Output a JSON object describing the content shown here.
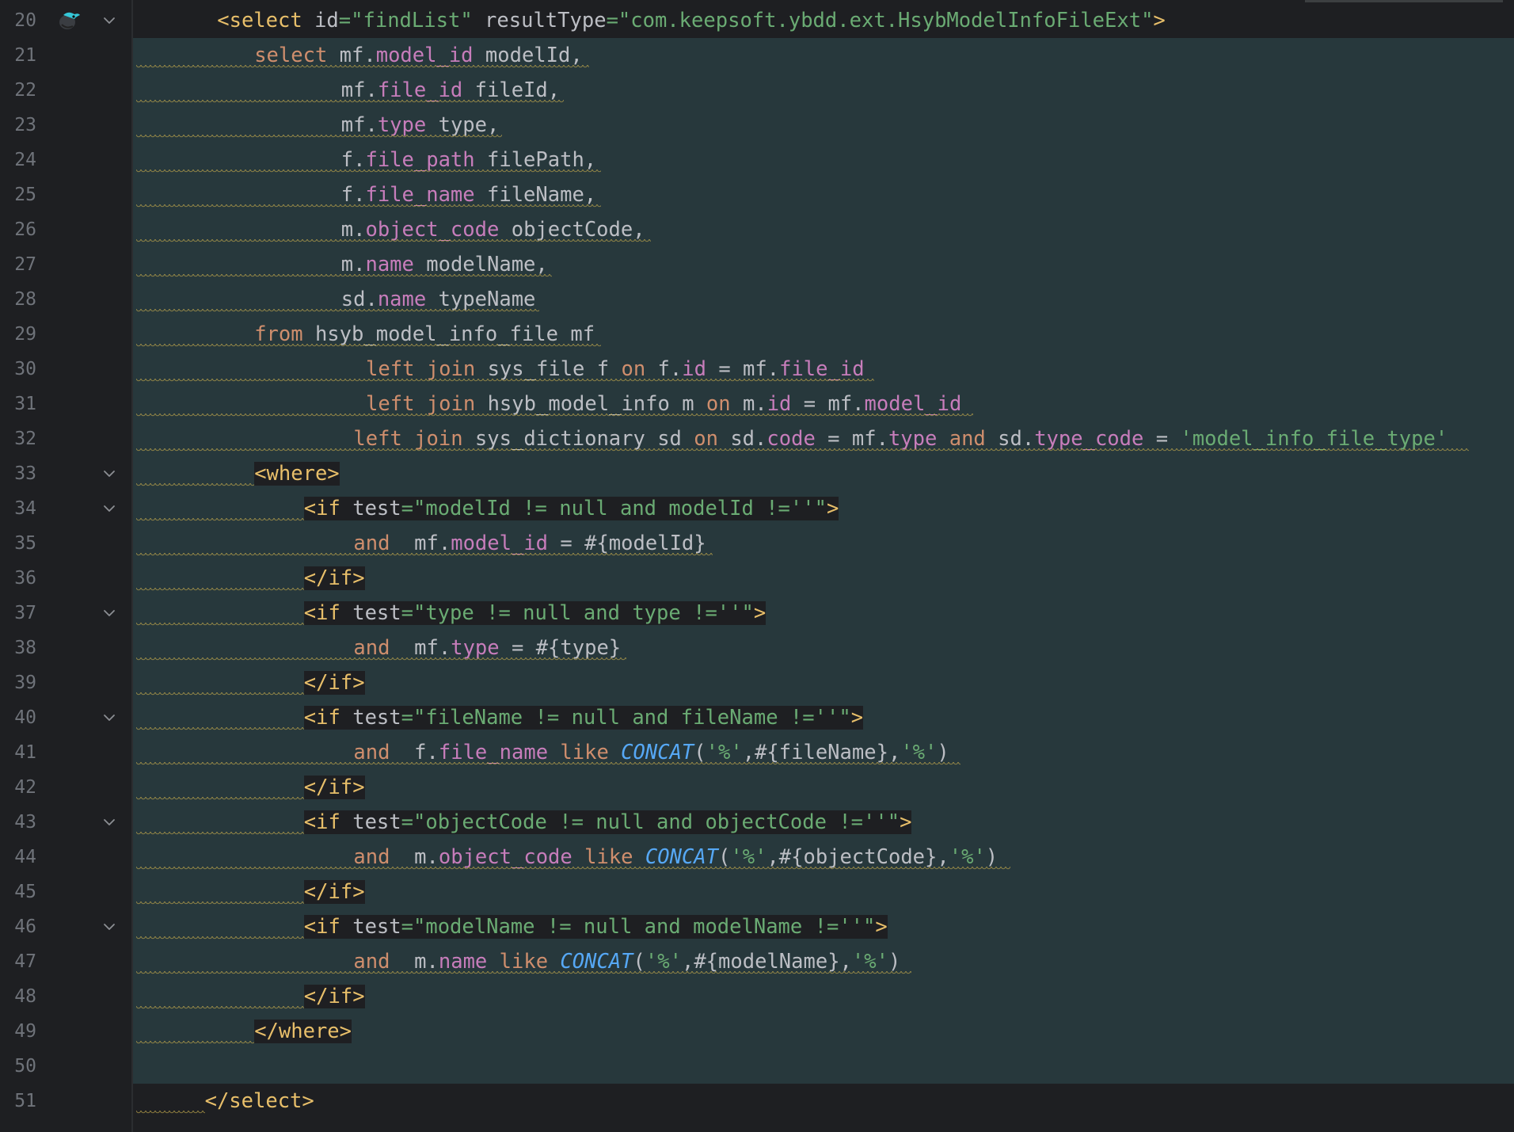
{
  "editor": {
    "file_language": "MyBatis mapper XML",
    "colors": {
      "background": "#1e1f22",
      "injected_background": "#27383c",
      "tag": "#e8bf6a",
      "keyword": "#cf8e6d",
      "field": "#c77dbb",
      "string": "#6aab73",
      "function": "#56a8f5",
      "line_number": "#6f737a",
      "warning_squiggle": "#bda54b"
    }
  },
  "lines": [
    {
      "num": "20",
      "indent": 5,
      "fold": true,
      "icon": "mapper-bird-icon",
      "bg": "none",
      "tokens": [
        {
          "t": "<select ",
          "c": "tag",
          "box": true
        },
        {
          "t": "id",
          "c": "attr",
          "box": true
        },
        {
          "t": "=\"findList\" ",
          "c": "aval",
          "box": true
        },
        {
          "t": "resultType",
          "c": "attr",
          "box": true
        },
        {
          "t": "=\"com.keepsoft.ybdd.ext.HsybModelInfoFileExt\"",
          "c": "aval",
          "box": true
        },
        {
          "t": ">",
          "c": "tag",
          "box": true
        }
      ]
    },
    {
      "num": "21",
      "indent": 8,
      "bg": "inj",
      "tokens": [
        {
          "t": "select ",
          "c": "kw"
        },
        {
          "t": "mf.",
          "c": "id"
        },
        {
          "t": "model_id",
          "c": "fld"
        },
        {
          "t": " modelId,",
          "c": "id"
        }
      ]
    },
    {
      "num": "22",
      "indent": 15,
      "bg": "inj",
      "tokens": [
        {
          "t": "mf.",
          "c": "id"
        },
        {
          "t": "file_id",
          "c": "fld"
        },
        {
          "t": " fileId,",
          "c": "id"
        }
      ]
    },
    {
      "num": "23",
      "indent": 15,
      "bg": "inj",
      "tokens": [
        {
          "t": "mf.",
          "c": "id"
        },
        {
          "t": "type",
          "c": "fld"
        },
        {
          "t": " type,",
          "c": "id"
        }
      ]
    },
    {
      "num": "24",
      "indent": 15,
      "bg": "inj",
      "tokens": [
        {
          "t": "f.",
          "c": "id"
        },
        {
          "t": "file_path",
          "c": "fld"
        },
        {
          "t": " filePath,",
          "c": "id"
        }
      ]
    },
    {
      "num": "25",
      "indent": 15,
      "bg": "inj",
      "tokens": [
        {
          "t": "f.",
          "c": "id"
        },
        {
          "t": "file_name",
          "c": "fld"
        },
        {
          "t": " fileName,",
          "c": "id"
        }
      ]
    },
    {
      "num": "26",
      "indent": 15,
      "bg": "inj",
      "tokens": [
        {
          "t": "m.",
          "c": "id"
        },
        {
          "t": "object_code",
          "c": "fld"
        },
        {
          "t": " objectCode,",
          "c": "id"
        }
      ]
    },
    {
      "num": "27",
      "indent": 15,
      "bg": "inj",
      "tokens": [
        {
          "t": "m.",
          "c": "id"
        },
        {
          "t": "name",
          "c": "fld"
        },
        {
          "t": " modelName,",
          "c": "id"
        }
      ]
    },
    {
      "num": "28",
      "indent": 15,
      "bg": "inj",
      "tokens": [
        {
          "t": "sd.",
          "c": "id"
        },
        {
          "t": "name",
          "c": "fld"
        },
        {
          "t": " typeName",
          "c": "id"
        }
      ]
    },
    {
      "num": "29",
      "indent": 8,
      "bg": "inj",
      "tokens": [
        {
          "t": "from ",
          "c": "kw"
        },
        {
          "t": "hsyb_model_info_file mf",
          "c": "id"
        }
      ]
    },
    {
      "num": "30",
      "indent": 17,
      "bg": "inj",
      "tokens": [
        {
          "t": "left join ",
          "c": "kw"
        },
        {
          "t": "sys_file f ",
          "c": "id"
        },
        {
          "t": "on ",
          "c": "kw"
        },
        {
          "t": "f.",
          "c": "id"
        },
        {
          "t": "id",
          "c": "fld"
        },
        {
          "t": " = mf.",
          "c": "id"
        },
        {
          "t": "file_id",
          "c": "fld"
        }
      ]
    },
    {
      "num": "31",
      "indent": 17,
      "bg": "inj",
      "tokens": [
        {
          "t": "left join ",
          "c": "kw"
        },
        {
          "t": "hsyb_model_info m ",
          "c": "id"
        },
        {
          "t": "on ",
          "c": "kw"
        },
        {
          "t": "m.",
          "c": "id"
        },
        {
          "t": "id",
          "c": "fld"
        },
        {
          "t": " = mf.",
          "c": "id"
        },
        {
          "t": "model_id",
          "c": "fld"
        }
      ]
    },
    {
      "num": "32",
      "indent": 16,
      "bg": "inj",
      "tokens": [
        {
          "t": "left join ",
          "c": "kw"
        },
        {
          "t": "sys_dictionary sd ",
          "c": "id"
        },
        {
          "t": "on ",
          "c": "kw"
        },
        {
          "t": "sd.",
          "c": "id"
        },
        {
          "t": "code",
          "c": "fld"
        },
        {
          "t": " = mf.",
          "c": "id"
        },
        {
          "t": "type",
          "c": "fld"
        },
        {
          "t": " and ",
          "c": "kw"
        },
        {
          "t": "sd.",
          "c": "id"
        },
        {
          "t": "type_code",
          "c": "fld"
        },
        {
          "t": " = ",
          "c": "id"
        },
        {
          "t": "'model_info_file_type'",
          "c": "str"
        }
      ]
    },
    {
      "num": "33",
      "indent": 8,
      "fold": true,
      "bg": "inj",
      "tokens": [
        {
          "t": "<where>",
          "c": "tag",
          "box": true
        }
      ]
    },
    {
      "num": "34",
      "indent": 12,
      "fold": true,
      "bg": "inj",
      "tokens": [
        {
          "t": "<if ",
          "c": "tag",
          "box": true
        },
        {
          "t": "test",
          "c": "attr",
          "box": true
        },
        {
          "t": "=\"modelId != null and modelId !=''\"",
          "c": "aval",
          "box": true
        },
        {
          "t": ">",
          "c": "tag",
          "box": true
        }
      ]
    },
    {
      "num": "35",
      "indent": 16,
      "bg": "inj",
      "tokens": [
        {
          "t": "and  ",
          "c": "kw"
        },
        {
          "t": "mf.",
          "c": "id"
        },
        {
          "t": "model_id",
          "c": "fld"
        },
        {
          "t": " = #{modelId}",
          "c": "id"
        }
      ]
    },
    {
      "num": "36",
      "indent": 12,
      "bg": "inj",
      "tokens": [
        {
          "t": "</if>",
          "c": "tag",
          "box": true
        }
      ]
    },
    {
      "num": "37",
      "indent": 12,
      "fold": true,
      "bg": "inj",
      "tokens": [
        {
          "t": "<if ",
          "c": "tag",
          "box": true
        },
        {
          "t": "test",
          "c": "attr",
          "box": true
        },
        {
          "t": "=\"type != null and type !=''\"",
          "c": "aval",
          "box": true
        },
        {
          "t": ">",
          "c": "tag",
          "box": true
        }
      ]
    },
    {
      "num": "38",
      "indent": 16,
      "bg": "inj",
      "tokens": [
        {
          "t": "and  ",
          "c": "kw"
        },
        {
          "t": "mf.",
          "c": "id"
        },
        {
          "t": "type",
          "c": "fld"
        },
        {
          "t": " = #{type}",
          "c": "id"
        }
      ]
    },
    {
      "num": "39",
      "indent": 12,
      "bg": "inj",
      "tokens": [
        {
          "t": "</if>",
          "c": "tag",
          "box": true
        }
      ]
    },
    {
      "num": "40",
      "indent": 12,
      "fold": true,
      "bg": "inj",
      "tokens": [
        {
          "t": "<if ",
          "c": "tag",
          "box": true
        },
        {
          "t": "test",
          "c": "attr",
          "box": true
        },
        {
          "t": "=\"fileName != null and fileName !=''\"",
          "c": "aval",
          "box": true
        },
        {
          "t": ">",
          "c": "tag",
          "box": true
        }
      ]
    },
    {
      "num": "41",
      "indent": 16,
      "bg": "inj",
      "tokens": [
        {
          "t": "and  ",
          "c": "kw"
        },
        {
          "t": "f.",
          "c": "id"
        },
        {
          "t": "file_name",
          "c": "fld"
        },
        {
          "t": " like ",
          "c": "kw"
        },
        {
          "t": "CONCAT",
          "c": "fn"
        },
        {
          "t": "(",
          "c": "id"
        },
        {
          "t": "'%'",
          "c": "str"
        },
        {
          "t": ",#{fileName},",
          "c": "id"
        },
        {
          "t": "'%'",
          "c": "str"
        },
        {
          "t": ")",
          "c": "id"
        }
      ]
    },
    {
      "num": "42",
      "indent": 12,
      "bg": "inj",
      "tokens": [
        {
          "t": "</if>",
          "c": "tag",
          "box": true
        }
      ]
    },
    {
      "num": "43",
      "indent": 12,
      "fold": true,
      "bg": "inj",
      "tokens": [
        {
          "t": "<if ",
          "c": "tag",
          "box": true
        },
        {
          "t": "test",
          "c": "attr",
          "box": true
        },
        {
          "t": "=\"objectCode != null and objectCode !=''\"",
          "c": "aval",
          "box": true
        },
        {
          "t": ">",
          "c": "tag",
          "box": true
        }
      ]
    },
    {
      "num": "44",
      "indent": 16,
      "bg": "inj",
      "tokens": [
        {
          "t": "and  ",
          "c": "kw"
        },
        {
          "t": "m.",
          "c": "id"
        },
        {
          "t": "object_code",
          "c": "fld"
        },
        {
          "t": " like ",
          "c": "kw"
        },
        {
          "t": "CONCAT",
          "c": "fn"
        },
        {
          "t": "(",
          "c": "id"
        },
        {
          "t": "'%'",
          "c": "str"
        },
        {
          "t": ",#{objectCode},",
          "c": "id"
        },
        {
          "t": "'%'",
          "c": "str"
        },
        {
          "t": ")",
          "c": "id"
        }
      ]
    },
    {
      "num": "45",
      "indent": 12,
      "bg": "inj",
      "tokens": [
        {
          "t": "</if>",
          "c": "tag",
          "box": true
        }
      ]
    },
    {
      "num": "46",
      "indent": 12,
      "fold": true,
      "bg": "inj",
      "tokens": [
        {
          "t": "<if ",
          "c": "tag",
          "box": true
        },
        {
          "t": "test",
          "c": "attr",
          "box": true
        },
        {
          "t": "=\"modelName != null and modelName !=''\"",
          "c": "aval",
          "box": true
        },
        {
          "t": ">",
          "c": "tag",
          "box": true
        }
      ]
    },
    {
      "num": "47",
      "indent": 16,
      "bg": "inj",
      "tokens": [
        {
          "t": "and  ",
          "c": "kw"
        },
        {
          "t": "m.",
          "c": "id"
        },
        {
          "t": "name",
          "c": "fld"
        },
        {
          "t": " like ",
          "c": "kw"
        },
        {
          "t": "CONCAT",
          "c": "fn"
        },
        {
          "t": "(",
          "c": "id"
        },
        {
          "t": "'%'",
          "c": "str"
        },
        {
          "t": ",#{modelName},",
          "c": "id"
        },
        {
          "t": "'%'",
          "c": "str"
        },
        {
          "t": ")",
          "c": "id"
        }
      ]
    },
    {
      "num": "48",
      "indent": 12,
      "bg": "inj",
      "tokens": [
        {
          "t": "</if>",
          "c": "tag",
          "box": true
        }
      ]
    },
    {
      "num": "49",
      "indent": 8,
      "bg": "inj",
      "tokens": [
        {
          "t": "</where>",
          "c": "tag",
          "box": true
        }
      ]
    },
    {
      "num": "50",
      "indent": 0,
      "bg": "inj",
      "tokens": []
    },
    {
      "num": "51",
      "indent": 4,
      "bg": "last",
      "tokens": [
        {
          "t": "</select>",
          "c": "tag",
          "box": true
        }
      ]
    }
  ]
}
